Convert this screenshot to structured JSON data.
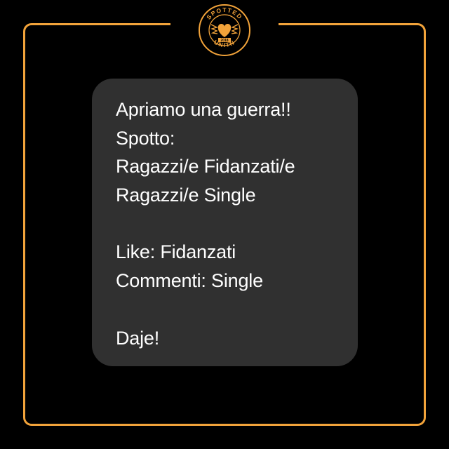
{
  "logo": {
    "top_text": "SPOTTED",
    "bottom_text": "UNITN",
    "band_text": "2018",
    "icon": "heart-icon",
    "accent": "#f2a33a"
  },
  "frame": {
    "color": "#f2a33a"
  },
  "post": {
    "background": "#303030",
    "lines": [
      "Apriamo una guerra!!",
      "Spotto:",
      "Ragazzi/e Fidanzati/e",
      "Ragazzi/e Single",
      "",
      "Like: Fidanzati",
      "Commenti: Single",
      "",
      "Daje!"
    ]
  }
}
